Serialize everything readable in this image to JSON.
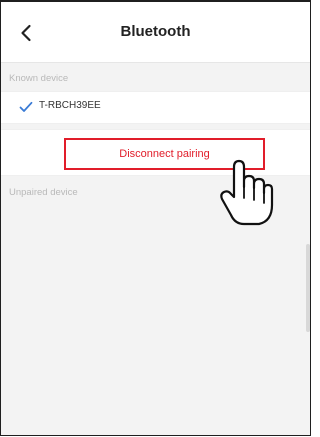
{
  "header": {
    "title": "Bluetooth",
    "back_icon": "chevron-left-icon"
  },
  "known_devices": {
    "section_label": "Known device",
    "items": [
      {
        "name": "T-RBCH39EE",
        "status_icon": "check-icon"
      }
    ]
  },
  "actions": {
    "disconnect_pairing_label": "Disconnect pairing"
  },
  "unpaired_devices": {
    "section_label": "Unpaired device"
  },
  "colors": {
    "accent": "#e11d2a",
    "check": "#3a7bd5"
  },
  "icons": {
    "hand": "hand-pointer-icon"
  }
}
